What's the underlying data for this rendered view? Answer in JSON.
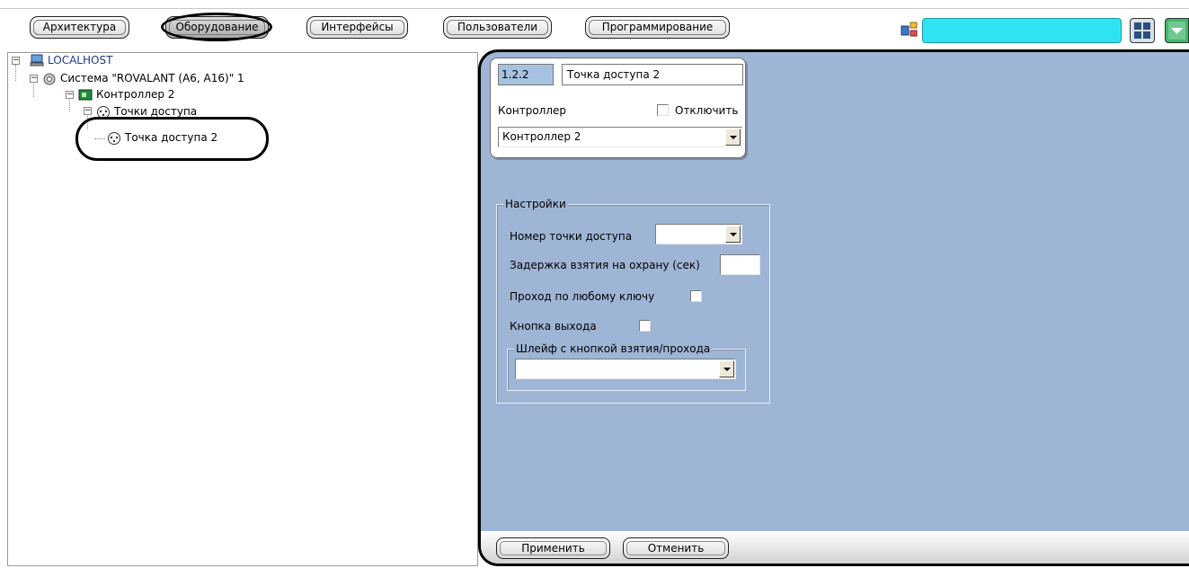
{
  "tabs": [
    {
      "label": "Архитектура"
    },
    {
      "label": "Оборудование",
      "active": true
    },
    {
      "label": "Интерфейсы"
    },
    {
      "label": "Пользователи"
    },
    {
      "label": "Программирование"
    }
  ],
  "toolbar": {
    "accent_color": "#2ee4f2",
    "icons": [
      "schema-icon",
      "layout-grid-icon",
      "chevron-down-icon"
    ]
  },
  "tree": {
    "items": [
      {
        "label": "LOCALHOST",
        "icon": "computer-icon",
        "expanded": true
      },
      {
        "label": "Система \"ROVALANT (A6, A16)\" 1",
        "icon": "system-gear-icon",
        "expanded": true
      },
      {
        "label": "Контроллер 2",
        "icon": "controller-board-icon",
        "expanded": true
      },
      {
        "label": "Точки доступа",
        "icon": "access-point-icon",
        "expanded": true
      },
      {
        "label": "Точка доступа 2",
        "icon": "access-point-icon",
        "selected": true
      }
    ]
  },
  "object": {
    "id": "1.2.2",
    "name": "Точка доступа 2",
    "controller_label": "Контроллер",
    "disable_label": "Отключить",
    "controller_value": "Контроллер 2"
  },
  "settings": {
    "title": "Настройки",
    "point_number_label": "Номер точки доступа",
    "point_number_value": "",
    "arm_delay_label": "Задержка взятия на охрану (сек)",
    "arm_delay_value": "",
    "any_key_label": "Проход по любому ключу",
    "exit_button_label": "Кнопка выхода",
    "loop_group_title": "Шлейф с кнопкой взятия/прохода",
    "loop_value": ""
  },
  "footer": {
    "apply_label": "Применить",
    "cancel_label": "Отменить"
  },
  "colors": {
    "panel_background": "#9fb5d6",
    "id_field_background": "#a6c2e0"
  }
}
